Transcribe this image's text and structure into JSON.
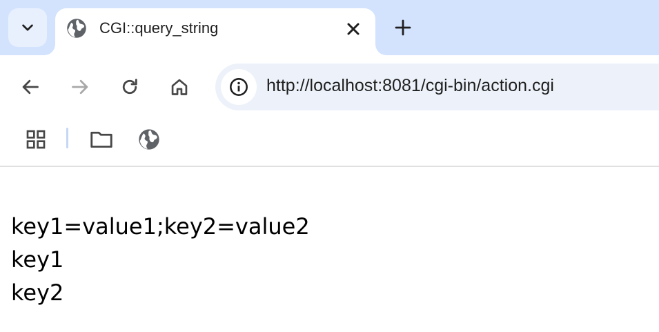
{
  "tab": {
    "title": "CGI::query_string",
    "favicon": "globe-icon",
    "close_icon": "close-icon"
  },
  "tabstrip": {
    "tab_search_icon": "chevron-down-icon",
    "new_tab_icon": "plus-icon"
  },
  "toolbar": {
    "back_icon": "arrow-left-icon",
    "forward_icon": "arrow-right-icon",
    "reload_icon": "reload-icon",
    "home_icon": "home-icon",
    "site_info_icon": "info-icon",
    "url": "http://localhost:8081/cgi-bin/action.cgi"
  },
  "bookmarks": {
    "apps_icon": "apps-grid-icon",
    "folder_icon": "folder-icon",
    "site_icon": "globe-icon"
  },
  "page": {
    "lines": [
      "key1=value1;key2=value2",
      "key1",
      "key2"
    ]
  },
  "colors": {
    "tabstrip_bg": "#d3e3fd",
    "omnibox_bg": "#edf2fa",
    "icon": "#474747",
    "icon_disabled": "#a8a8a8"
  }
}
